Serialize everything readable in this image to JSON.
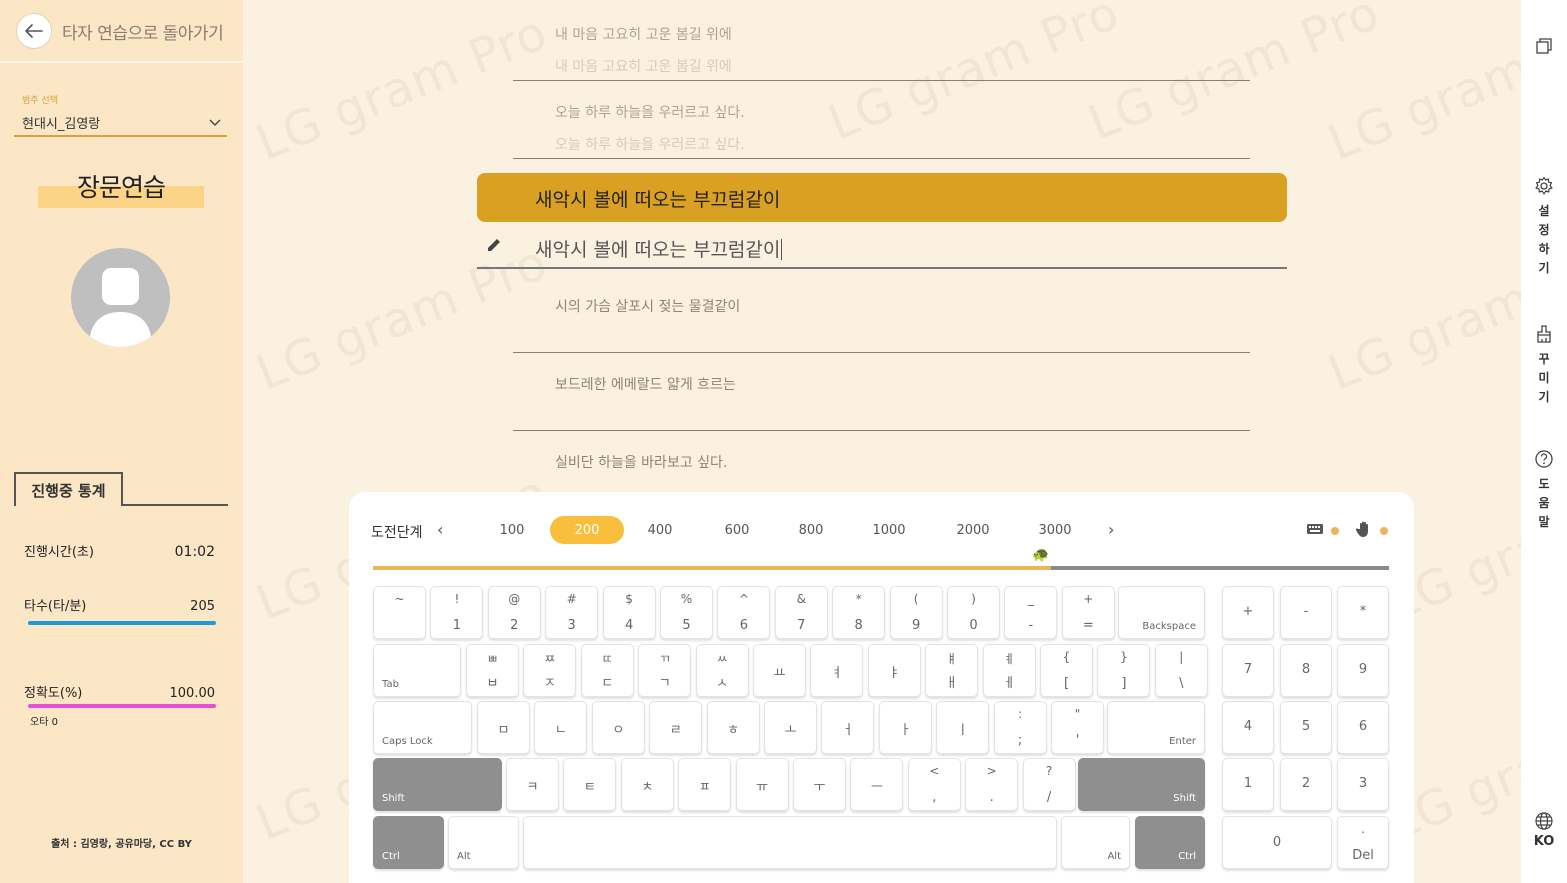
{
  "sidebar": {
    "back_label": "타자 연습으로 돌아가기",
    "category_label": "범주 선택",
    "category_value": "현대시_김영랑",
    "mode_title": "장문연습",
    "stats_title": "진행중 통계",
    "stats": {
      "time_label": "진행시간(초)",
      "time_value": "01:02",
      "speed_label": "타수(타/분)",
      "speed_value": "205",
      "accuracy_label": "정확도(%)",
      "accuracy_value": "100.00",
      "errors": "오타 0"
    },
    "source": "출처 : 김영랑, 공유마당, CC BY"
  },
  "watermark": "LG gram Pro",
  "lines": {
    "done1": "내 마음 고요히 고운 봄길 위에",
    "done1_typed": "내 마음 고요히 고운 봄길 위에",
    "done2": "오늘 하루 하늘을 우러르고 싶다.",
    "done2_typed": "오늘 하루 하늘을 우러르고 싶다.",
    "current": "새악시 볼에 떠오는 부끄럼같이",
    "typed": "새악시 볼에 떠오는 부끄럼같이",
    "next1": "시의 가슴 살포시 젖는 물결같이",
    "next2": "보드레한 에메랄드 얇게 흐르는",
    "next3": "실비단 하늘을 바라보고 싶다."
  },
  "levels": {
    "label": "도전단계",
    "items": [
      "100",
      "200",
      "400",
      "600",
      "800",
      "1000",
      "2000",
      "3000"
    ],
    "active": "200",
    "progress_fraction": 0.667
  },
  "keyboard": {
    "row1": [
      {
        "t": "~",
        "b": ""
      },
      {
        "t": "!",
        "b": "1"
      },
      {
        "t": "@",
        "b": "2"
      },
      {
        "t": "#",
        "b": "3"
      },
      {
        "t": "$",
        "b": "4"
      },
      {
        "t": "%",
        "b": "5"
      },
      {
        "t": "^",
        "b": "6"
      },
      {
        "t": "&",
        "b": "7"
      },
      {
        "t": "*",
        "b": "8"
      },
      {
        "t": "(",
        "b": "9"
      },
      {
        "t": ")",
        "b": "0"
      },
      {
        "t": "_",
        "b": "-"
      },
      {
        "t": "+",
        "b": "="
      }
    ],
    "backspace": "Backspace",
    "tab": "Tab",
    "row2": [
      {
        "t": "ㅃ",
        "b": "ㅂ"
      },
      {
        "t": "ㅉ",
        "b": "ㅈ"
      },
      {
        "t": "ㄸ",
        "b": "ㄷ"
      },
      {
        "t": "ㄲ",
        "b": "ㄱ"
      },
      {
        "t": "ㅆ",
        "b": "ㅅ"
      },
      {
        "t": "",
        "m": "ㅛ"
      },
      {
        "t": "",
        "m": "ㅕ"
      },
      {
        "t": "",
        "m": "ㅑ"
      },
      {
        "t": "ㅒ",
        "b": "ㅐ"
      },
      {
        "t": "ㅖ",
        "b": "ㅔ"
      },
      {
        "t": "{",
        "b": "["
      },
      {
        "t": "}",
        "b": "]"
      },
      {
        "t": "|",
        "b": "\\"
      }
    ],
    "capslock": "Caps Lock",
    "row3": [
      {
        "m": "ㅁ"
      },
      {
        "m": "ㄴ"
      },
      {
        "m": "ㅇ"
      },
      {
        "m": "ㄹ"
      },
      {
        "m": "ㅎ"
      },
      {
        "m": "ㅗ"
      },
      {
        "m": "ㅓ"
      },
      {
        "m": "ㅏ"
      },
      {
        "m": "ㅣ"
      },
      {
        "t": ":",
        "b": ";"
      },
      {
        "t": "\"",
        "b": "'"
      }
    ],
    "enter": "Enter",
    "shift": "Shift",
    "row4": [
      {
        "m": "ㅋ"
      },
      {
        "m": "ㅌ"
      },
      {
        "m": "ㅊ"
      },
      {
        "m": "ㅍ"
      },
      {
        "m": "ㅠ"
      },
      {
        "m": "ㅜ"
      },
      {
        "m": "ㅡ"
      },
      {
        "t": "<",
        "b": ","
      },
      {
        "t": ">",
        "b": "."
      },
      {
        "t": "?",
        "b": "/"
      }
    ],
    "ctrl": "Ctrl",
    "alt": "Alt",
    "numpad": {
      "ops": [
        "+",
        "-",
        "*"
      ],
      "r1": [
        "7",
        "8",
        "9"
      ],
      "r2": [
        "4",
        "5",
        "6"
      ],
      "r3": [
        "1",
        "2",
        "3"
      ],
      "zero": "0",
      "del_top": ".",
      "del": "Del"
    }
  },
  "rail": {
    "settings": "설정하기",
    "decorate": "꾸미기",
    "help": "도움말",
    "lang": "KO"
  },
  "colors": {
    "accent": "#daa022",
    "level_active": "#f9be3b",
    "speed_bar": "#1e9bd7",
    "accuracy_bar": "#e64fd6",
    "sidebar_bg": "#fbe7c6"
  }
}
